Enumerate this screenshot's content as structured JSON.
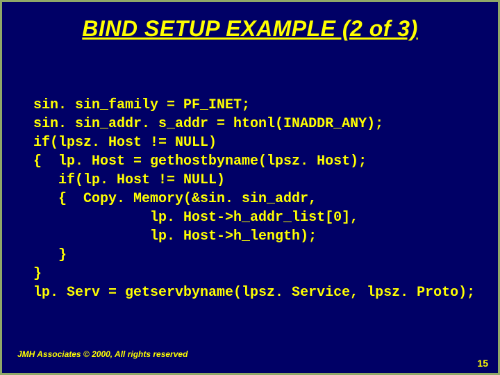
{
  "slide": {
    "title": "BIND SETUP EXAMPLE (2 of 3)",
    "code": "sin. sin_family = PF_INET;\nsin. sin_addr. s_addr = htonl(INADDR_ANY);\nif(lpsz. Host != NULL)\n{  lp. Host = gethostbyname(lpsz. Host);\n   if(lp. Host != NULL)\n   {  Copy. Memory(&sin. sin_addr,\n              lp. Host->h_addr_list[0],\n              lp. Host->h_length);\n   }\n}\nlp. Serv = getservbyname(lpsz. Service, lpsz. Proto);",
    "footer": "JMH Associates © 2000, All rights reserved",
    "page_number": "15"
  }
}
